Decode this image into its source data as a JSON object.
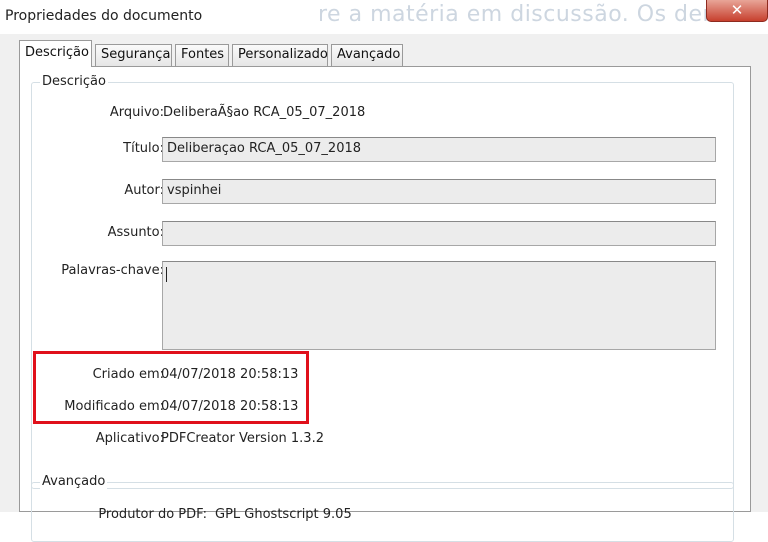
{
  "window": {
    "title": "Propriedades do documento",
    "background_text": "re a matéria em discussão. Os demais",
    "close_label": "✕"
  },
  "tabs": [
    {
      "label": "Descrição",
      "active": true
    },
    {
      "label": "Segurança",
      "active": false
    },
    {
      "label": "Fontes",
      "active": false
    },
    {
      "label": "Personalizado",
      "active": false
    },
    {
      "label": "Avançado",
      "active": false
    }
  ],
  "description": {
    "legend": "Descrição",
    "file_label": "Arquivo:",
    "file_value": "DeliberaÃ§ao RCA_05_07_2018",
    "title_label": "Título:",
    "title_value": "Deliberaçao RCA_05_07_2018",
    "author_label": "Autor:",
    "author_value": "vspinhei",
    "subject_label": "Assunto:",
    "subject_value": "",
    "keywords_label": "Palavras-chave:",
    "keywords_value": "",
    "created_label": "Criado em:",
    "created_value": "04/07/2018 20:58:13",
    "modified_label": "Modificado em:",
    "modified_value": "04/07/2018 20:58:13",
    "app_label": "Aplicativo:",
    "app_value": "PDFCreator Version 1.3.2"
  },
  "advanced": {
    "legend": "Avançado",
    "producer_label": "Produtor do PDF:",
    "producer_value": "GPL Ghostscript 9.05"
  },
  "colors": {
    "highlight_border": "#e0101b",
    "close_button": "#c7402e"
  }
}
